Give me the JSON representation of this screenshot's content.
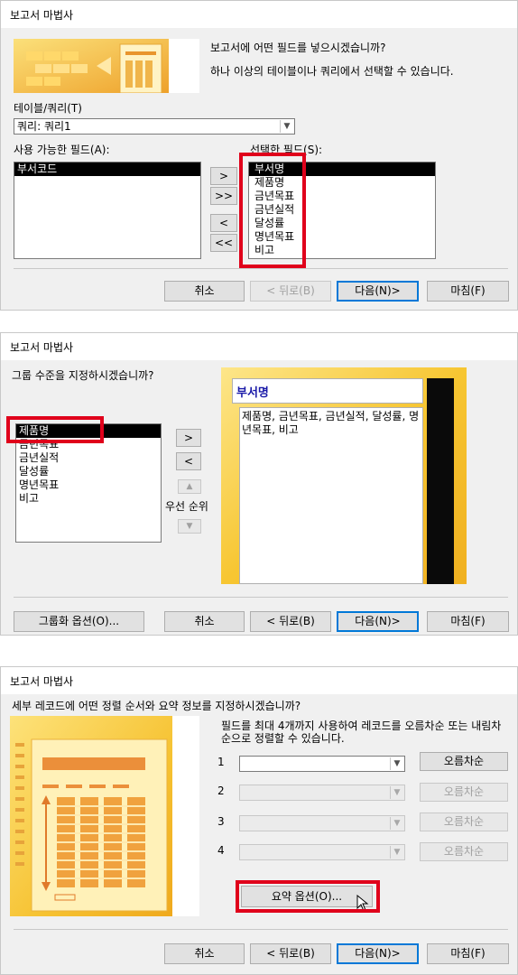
{
  "dialog1": {
    "title": "보고서 마법사",
    "question": "보고서에 어떤 필드를 넣으시겠습니까?",
    "subtext": "하나 이상의 테이블이나 쿼리에서 선택할 수 있습니다.",
    "table_label": "테이블/쿼리(T)",
    "table_value": "쿼리: 쿼리1",
    "available_label": "사용 가능한 필드(A):",
    "selected_label": "선택한 필드(S):",
    "available_fields": [
      "부서코드"
    ],
    "selected_fields": [
      "부서명",
      "제품명",
      "금년목표",
      "금년실적",
      "달성률",
      "명년목표",
      "비고"
    ],
    "move_buttons": [
      ">",
      ">>",
      "<",
      "<<"
    ],
    "buttons": {
      "cancel": "취소",
      "back": "< 뒤로(B)",
      "next": "다음(N)>",
      "finish": "마침(F)"
    }
  },
  "dialog2": {
    "title": "보고서 마법사",
    "question": "그룹 수준을 지정하시겠습니까?",
    "fields": [
      "제품명",
      "금년목표",
      "금년실적",
      "달성률",
      "명년목표",
      "비고"
    ],
    "move_buttons": [
      ">",
      "<"
    ],
    "priority_label": "우선 순위",
    "preview_group": "부서명",
    "preview_fields": "제품명, 금년목표, 금년실적, 달성률, 명년목표, 비고",
    "buttons": {
      "grouping_options": "그룹화 옵션(O)...",
      "cancel": "취소",
      "back": "< 뒤로(B)",
      "next": "다음(N)>",
      "finish": "마침(F)"
    }
  },
  "dialog3": {
    "title": "보고서 마법사",
    "question": "세부 레코드에 어떤 정렬 순서와 요약 정보를 지정하시겠습니까?",
    "description": "필드를 최대 4개까지 사용하여 레코드를 오름차순 또는 내림차순으로 정렬할 수 있습니다.",
    "sort_rows": [
      {
        "num": "1",
        "value": "",
        "order": "오름차순"
      },
      {
        "num": "2",
        "value": "",
        "order": "오름차순"
      },
      {
        "num": "3",
        "value": "",
        "order": "오름차순"
      },
      {
        "num": "4",
        "value": "",
        "order": "오름차순"
      }
    ],
    "summary_button": "요약 옵션(O)...",
    "buttons": {
      "cancel": "취소",
      "back": "< 뒤로(B)",
      "next": "다음(N)>",
      "finish": "마침(F)"
    }
  },
  "colors": {
    "dialog_bg": "#f0f0f0",
    "highlight_red": "#e0001b",
    "focus_blue": "#0078d7",
    "wizard_yellow": "#fdd835",
    "wizard_orange": "#ef9a3c"
  }
}
